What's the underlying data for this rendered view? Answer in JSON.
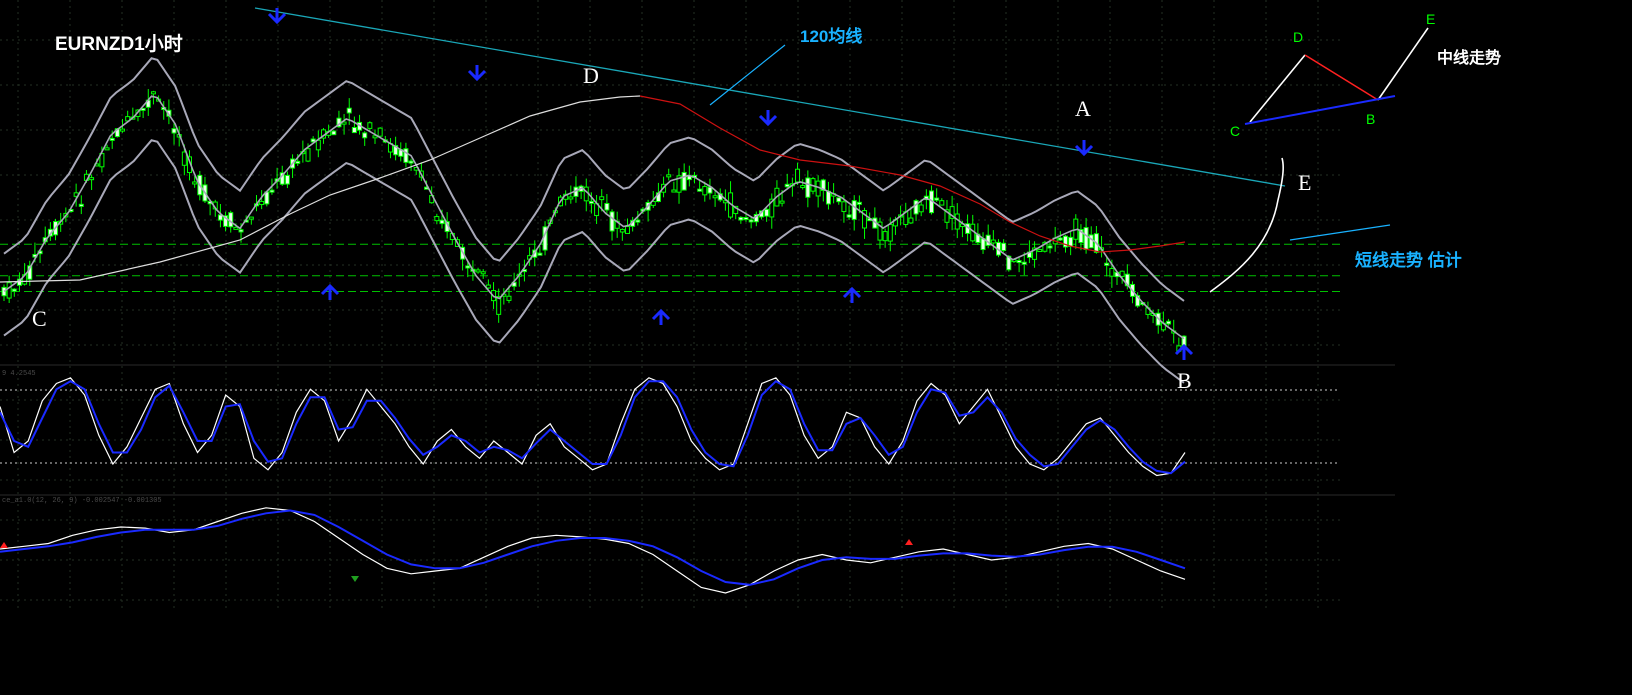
{
  "title": "EURNZD1小时",
  "colors": {
    "background": "#000000",
    "grid": "#243024",
    "candle": "#00ff00",
    "bollinger": "#a8a8b8",
    "ma120": "#cc1111",
    "trendline": "#1aa7b8",
    "stoch_main": "#ffffff",
    "stoch_signal": "#1a2aff",
    "arrow": "#1a2aff",
    "annotation_line": "#19b2ff",
    "level": "#00c000"
  },
  "icons": {
    "top_marker": "down-arrow-icon",
    "bottom_marker": "up-arrow-icon"
  },
  "annotations": {
    "ma120_label": "120均线",
    "short_term_label": "短线走势 估计",
    "mid_term_label": "中线走势",
    "points": {
      "A": "A",
      "B": "B",
      "C": "C",
      "D": "D",
      "E": "E"
    }
  },
  "subwindow_labels": {
    "stochastic": "9 4.2545",
    "macd": "ce_a1.0(12, 26, 9) -0.002547 -0.001305"
  },
  "chart_data": [
    {
      "type": "line",
      "panel": "price",
      "symbol": "EURNZD",
      "timeframe": "H1",
      "series": [
        {
          "values": [
            0.25,
            0.3,
            0.42,
            0.5,
            0.62,
            0.75,
            0.8,
            0.88,
            0.78,
            0.6,
            0.5,
            0.45,
            0.55,
            0.62,
            0.7,
            0.75,
            0.8,
            0.76,
            0.72,
            0.68,
            0.55,
            0.42,
            0.3,
            0.22,
            0.3,
            0.4,
            0.55,
            0.58,
            0.5,
            0.45,
            0.52,
            0.6,
            0.62,
            0.58,
            0.52,
            0.48,
            0.55,
            0.6,
            0.58,
            0.55,
            0.5,
            0.45,
            0.5,
            0.55,
            0.5,
            0.45,
            0.4,
            0.35,
            0.38,
            0.42,
            0.45,
            0.4,
            0.3,
            0.22,
            0.15,
            0.1
          ]
        },
        {
          "values": [
            0.46,
            0.47,
            0.48,
            0.5,
            0.52,
            0.54,
            0.57,
            0.6,
            0.62,
            0.62,
            0.6,
            0.58,
            0.56,
            0.55,
            0.55,
            0.56,
            0.58,
            0.6,
            0.62,
            0.63,
            0.62,
            0.6,
            0.57,
            0.55,
            0.55,
            0.56,
            0.58,
            0.6,
            0.6,
            0.58,
            0.56,
            0.55,
            0.55,
            0.56,
            0.55,
            0.54,
            0.53,
            0.53,
            0.54,
            0.55,
            0.55,
            0.54,
            0.53,
            0.52,
            0.51,
            0.5,
            0.49,
            0.48,
            0.47,
            0.46,
            0.45,
            0.44,
            0.43,
            0.42,
            0.41,
            0.4
          ]
        }
      ],
      "levels": [
        0.32,
        0.22,
        0.17
      ]
    },
    {
      "type": "line",
      "panel": "stochastic",
      "ylim": [
        0,
        100
      ],
      "levels": [
        80,
        20
      ],
      "series": [
        {
          "values": [
            70,
            30,
            40,
            75,
            90,
            95,
            80,
            45,
            20,
            35,
            60,
            85,
            90,
            55,
            30,
            45,
            80,
            70,
            25,
            15,
            30,
            65,
            85,
            75,
            40,
            60,
            85,
            70,
            55,
            35,
            20,
            40,
            50,
            35,
            25,
            40,
            30,
            20,
            45,
            55,
            35,
            25,
            15,
            20,
            55,
            85,
            95,
            90,
            70,
            40,
            25,
            15,
            20,
            55,
            90,
            95,
            80,
            45,
            25,
            35,
            65,
            60,
            35,
            20,
            40,
            75,
            90,
            80,
            55,
            70,
            85,
            60,
            35,
            20,
            15,
            25,
            40,
            55,
            60,
            45,
            30,
            18,
            10,
            12,
            30
          ]
        },
        {
          "values": [
            65,
            40,
            35,
            60,
            85,
            92,
            85,
            55,
            30,
            30,
            50,
            78,
            88,
            65,
            40,
            40,
            70,
            72,
            40,
            22,
            25,
            55,
            78,
            78,
            50,
            52,
            75,
            75,
            60,
            42,
            28,
            35,
            45,
            40,
            30,
            35,
            32,
            25,
            38,
            50,
            40,
            30,
            20,
            20,
            45,
            78,
            92,
            92,
            78,
            50,
            30,
            20,
            18,
            45,
            80,
            92,
            85,
            55,
            32,
            32,
            55,
            60,
            45,
            28,
            35,
            65,
            85,
            82,
            62,
            65,
            78,
            65,
            42,
            28,
            18,
            20,
            35,
            50,
            58,
            50,
            35,
            22,
            14,
            12,
            22
          ]
        }
      ]
    },
    {
      "type": "line",
      "panel": "macd",
      "series": [
        {
          "values": [
            0.2,
            0.25,
            0.3,
            0.45,
            0.55,
            0.6,
            0.58,
            0.5,
            0.55,
            0.7,
            0.85,
            0.95,
            0.9,
            0.7,
            0.4,
            0.1,
            -0.15,
            -0.25,
            -0.2,
            -0.15,
            0.05,
            0.25,
            0.4,
            0.45,
            0.42,
            0.38,
            0.3,
            0.1,
            -0.2,
            -0.5,
            -0.6,
            -0.45,
            -0.2,
            0.0,
            0.1,
            0.0,
            -0.05,
            0.05,
            0.15,
            0.2,
            0.1,
            0.0,
            0.05,
            0.15,
            0.25,
            0.3,
            0.2,
            0.0,
            -0.2,
            -0.35
          ]
        },
        {
          "values": [
            0.15,
            0.2,
            0.25,
            0.32,
            0.42,
            0.5,
            0.55,
            0.55,
            0.55,
            0.62,
            0.75,
            0.85,
            0.9,
            0.82,
            0.6,
            0.35,
            0.1,
            -0.08,
            -0.15,
            -0.15,
            -0.05,
            0.1,
            0.25,
            0.35,
            0.4,
            0.4,
            0.35,
            0.25,
            0.05,
            -0.2,
            -0.4,
            -0.45,
            -0.35,
            -0.15,
            0.0,
            0.05,
            0.02,
            0.02,
            0.08,
            0.12,
            0.12,
            0.08,
            0.06,
            0.1,
            0.18,
            0.24,
            0.24,
            0.15,
            0.0,
            -0.15
          ]
        }
      ]
    }
  ]
}
